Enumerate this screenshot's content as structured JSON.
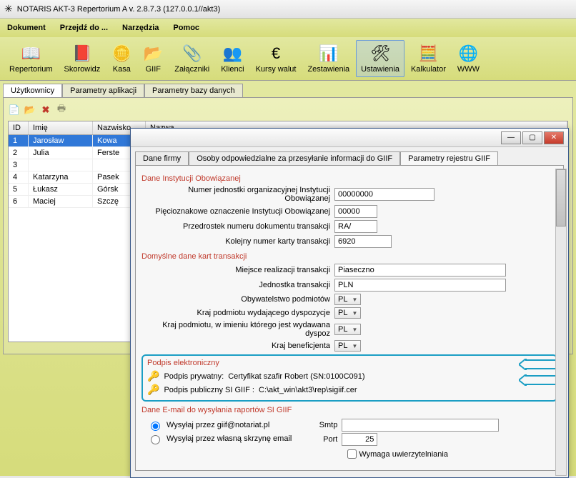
{
  "window": {
    "title": "NOTARIS AKT-3 Repertorium A v. 2.8.7.3 (127.0.0.1//akt3)"
  },
  "menu": {
    "dokument": "Dokument",
    "przejdz": "Przejdź do ...",
    "narzedzia": "Narzędzia",
    "pomoc": "Pomoc"
  },
  "toolbar": {
    "repertorium": "Repertorium",
    "skorowidz": "Skorowidz",
    "kasa": "Kasa",
    "giif": "GIIF",
    "zalaczniki": "Załączniki",
    "klienci": "Klienci",
    "kursy": "Kursy walut",
    "zestawienia": "Zestawienia",
    "ustawienia": "Ustawienia",
    "kalkulator": "Kalkulator",
    "www": "WWW"
  },
  "mainTabs": {
    "uzytkownicy": "Użytkownicy",
    "paramApp": "Parametry aplikacji",
    "paramDb": "Parametry bazy danych"
  },
  "table": {
    "headers": {
      "id": "ID",
      "imie": "Imię",
      "nazwisko": "Nazwisko",
      "nazwa": "Nazwa"
    },
    "rows": [
      {
        "id": "1",
        "imie": "Jarosław",
        "naz": "Kowa"
      },
      {
        "id": "2",
        "imie": "Julia",
        "naz": "Ferste"
      },
      {
        "id": "3",
        "imie": "",
        "naz": ""
      },
      {
        "id": "4",
        "imie": "Katarzyna",
        "naz": "Pasek"
      },
      {
        "id": "5",
        "imie": "Łukasz",
        "naz": "Górsk"
      },
      {
        "id": "6",
        "imie": "Maciej",
        "naz": "Szczę"
      }
    ]
  },
  "dialog": {
    "tabs": {
      "danefirmy": "Dane firmy",
      "osoby": "Osoby odpowiedzialne za przesyłanie informacji do GIIF",
      "paramgiif": "Parametry rejestru GIIF"
    },
    "groups": {
      "instytucja": "Dane Instytucji Obowiązanej",
      "domyslne": "Domyślne dane kart transakcji",
      "podpis": "Podpis elektroniczny",
      "email": "Dane E-mail do wysyłania raportów SI GIIF"
    },
    "labels": {
      "numerJedn": "Numer jednostki organizacyjnej Instytucji Obowiązanej",
      "piecio": "Pięcioznakowe oznaczenie Instytucji Obowiązanej",
      "przedrostek": "Przedrostek numeru dokumentu transakcji",
      "kolejny": "Kolejny numer karty transakcji",
      "miejsce": "Miejsce realizacji transakcji",
      "jednostka": "Jednostka transakcji",
      "obyw": "Obywatelstwo podmiotów",
      "krajWyd": "Kraj podmiotu wydającego dyspozycje",
      "krajImieniu": "Kraj podmiotu, w imieniu którego jest wydawana dyspoz",
      "krajBen": "Kraj beneficjenta",
      "podpisPryw": "Podpis prywatny:",
      "podpisPub": "Podpis publiczny SI GIIF :",
      "smtp": "Smtp",
      "port": "Port",
      "wymaga": "Wymaga uwierzytelniania"
    },
    "values": {
      "numerJedn": "00000000",
      "piecio": "00000",
      "przedrostek": "RA/",
      "kolejny": "6920",
      "miejsce": "Piaseczno",
      "jednostka": "PLN",
      "pl": "PL",
      "cert": "Certyfikat szafir Robert (SN:0100C091)",
      "certPath": "C:\\akt_win\\akt3\\rep\\sigiif.cer",
      "port": "25"
    },
    "radios": {
      "giifmail": "Wysyłaj przez giif@notariat.pl",
      "wlasna": "Wysyłaj przez własną skrzynę email"
    }
  }
}
